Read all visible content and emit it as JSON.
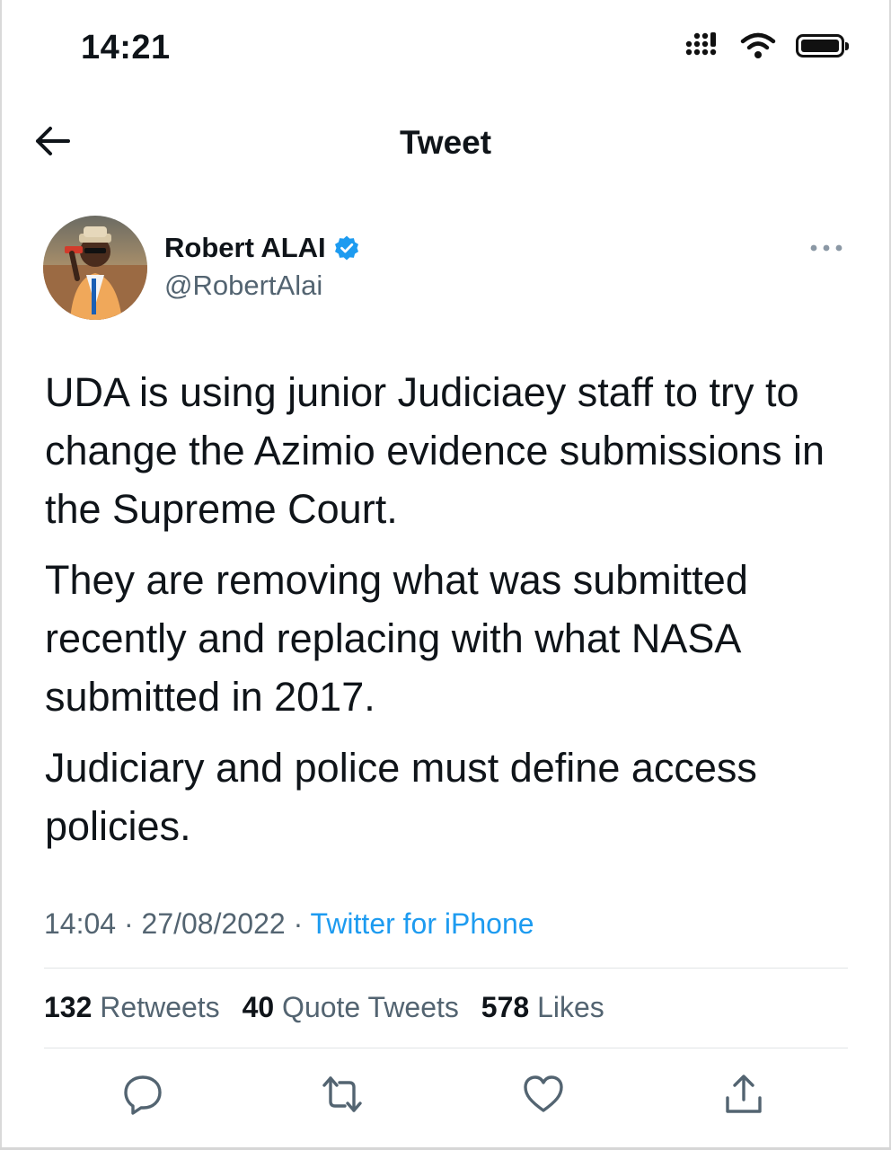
{
  "status_bar": {
    "time": "14:21"
  },
  "header": {
    "title": "Tweet"
  },
  "tweet": {
    "author_name": "Robert ALAI",
    "handle": "@RobertAlai",
    "paragraphs": [
      "UDA is using junior Judiciaey staff to try to change the Azimio evidence submissions in the Supreme Court.",
      "They are removing what was submitted recently and replacing with what NASA submitted in 2017.",
      "Judiciary and police must define access policies."
    ],
    "time": "14:04",
    "date": "27/08/2022",
    "separator": "·",
    "source": "Twitter for iPhone"
  },
  "stats": {
    "retweets_count": "132",
    "retweets_label": "Retweets",
    "quotes_count": "40",
    "quotes_label": "Quote Tweets",
    "likes_count": "578",
    "likes_label": "Likes"
  },
  "colors": {
    "accent": "#1d9bf0",
    "text": "#0f1419",
    "secondary": "#536471"
  },
  "icons": {
    "back": "arrow-left-icon",
    "verified": "verified-badge-icon",
    "more": "more-icon",
    "reply": "reply-icon",
    "retweet": "retweet-icon",
    "like": "heart-icon",
    "share": "share-icon",
    "signal": "signal-icon",
    "wifi": "wifi-icon",
    "battery": "battery-icon"
  }
}
